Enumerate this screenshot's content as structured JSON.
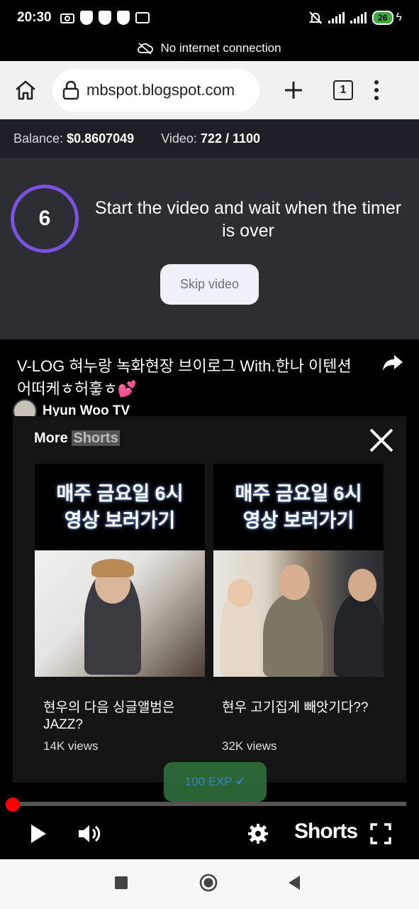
{
  "status_bar": {
    "time": "20:30",
    "battery": "26",
    "icons": [
      "camera-icon",
      "shield-icon",
      "shield-icon",
      "shield-icon",
      "window-icon",
      "mute-icon",
      "signal-icon",
      "signal-icon",
      "charging-icon"
    ]
  },
  "offline_banner": {
    "text": "No internet connection",
    "icon": "cloud-off-icon"
  },
  "browser": {
    "url": "mbspot.blogspot.com",
    "tab_count": "1",
    "icons": [
      "home-icon",
      "lock-icon",
      "plus-icon",
      "tabs-icon",
      "more-vert-icon"
    ]
  },
  "stats": {
    "balance_label": "Balance:",
    "balance_value": "$0.8607049",
    "video_label": "Video:",
    "video_value": "722 / 1100"
  },
  "timer": {
    "count": "6",
    "instruction": "Start the video and wait when the timer is over",
    "accent": "#7b53e0",
    "skip_label": "Skip video"
  },
  "video": {
    "title": "V-LOG 혀누랑 녹화현장 브이로그 With.한나 이텐션 어떠케ㅎ허훟ㅎ💕",
    "channel": "Hyun Woo TV",
    "more_shorts": {
      "label_more": "More",
      "label_shorts": "Shorts"
    },
    "cards": [
      {
        "banner_line1": "매주 금요일 6시",
        "banner_line2": "영상 보러가기",
        "caption": "현우의 다음 싱글앨범은 JAZZ?",
        "views": "14K views"
      },
      {
        "banner_line1": "매주 금요일 6시",
        "banner_line2": "영상 보러가기",
        "caption": "현우 고기집게 빼앗기다??",
        "views": "32K views"
      }
    ],
    "exp_badge": "100 EXP ✔",
    "progress_fraction": 0.0,
    "controls": {
      "shorts_label": "Shorts"
    }
  },
  "nav": {
    "icons": [
      "recents-icon",
      "home-circle-icon",
      "back-icon"
    ]
  }
}
